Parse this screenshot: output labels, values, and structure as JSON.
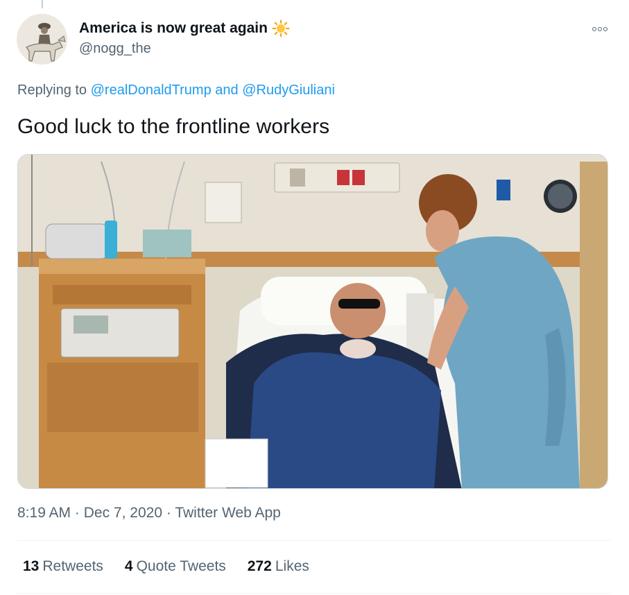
{
  "tweet": {
    "author": {
      "display_name": "America is now great again",
      "name_emoji": "sun-icon",
      "handle": "@nogg_the"
    },
    "replying": {
      "prefix": "Replying to",
      "mention1": "@realDonaldTrump",
      "conjunction": "and",
      "mention2": "@RudyGiuliani"
    },
    "text": "Good luck to the frontline workers",
    "media": {
      "kind": "photo",
      "description_icon": "photo"
    },
    "meta": {
      "time": "8:19 AM",
      "separator": "·",
      "date": "Dec 7, 2020",
      "source": "Twitter Web App"
    },
    "stats": {
      "retweets_count": "13",
      "retweets_label": "Retweets",
      "quotes_count": "4",
      "quotes_label": "Quote Tweets",
      "likes_count": "272",
      "likes_label": "Likes"
    }
  },
  "colors": {
    "link": "#1d9bf0",
    "secondary_text": "#536471",
    "primary_text": "#0f1419",
    "divider": "#eff3f4"
  }
}
